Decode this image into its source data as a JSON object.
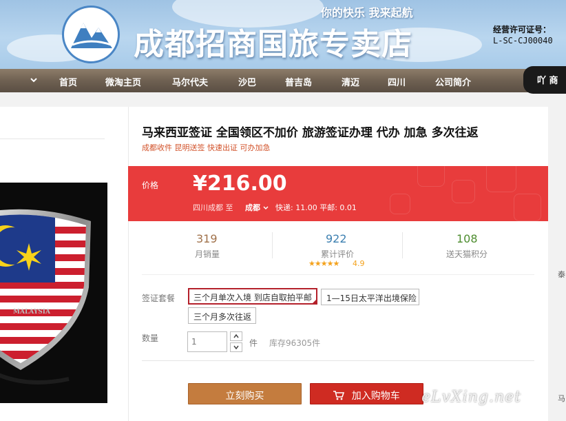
{
  "banner": {
    "store_name": "成都招商国旅专卖店",
    "slogan": "你的快乐  我来起航",
    "license_label": "经营许可证号：",
    "license_value": "L-SC-CJ00040"
  },
  "nav": {
    "items": [
      "首页",
      "微淘主页",
      "马尔代夫",
      "沙巴",
      "普吉岛",
      "清迈",
      "四川",
      "公司简介"
    ],
    "extra": "吖 商"
  },
  "product": {
    "title": "马来西亚签证 全国领区不加价 旅游签证办理 代办 加急 多次往返",
    "subtitle": "成都收件 昆明送签 快速出证 可办加急",
    "price_label": "价格",
    "price": "¥216.00",
    "ship_from": "四川成都  至",
    "ship_to": "成都",
    "ship_fees": "快递: 11.00  平邮: 0.01"
  },
  "stats": [
    {
      "value": "319",
      "label": "月销量",
      "color": "#a0714a"
    },
    {
      "value": "922",
      "label": "累计评价",
      "color": "#3c7fb0"
    },
    {
      "value": "108",
      "label": "送天猫积分",
      "color": "#4c8c2e"
    }
  ],
  "rating": {
    "stars": "★★★★★",
    "score": "4.9"
  },
  "package": {
    "label": "签证套餐",
    "options": [
      "三个月单次入境 到店自取拍平邮",
      "1—15日太平洋出境保险",
      "三个月多次往返"
    ],
    "selected_index": 0
  },
  "quantity": {
    "label": "数量",
    "value": "1",
    "unit": "件",
    "stock": "库存96305件"
  },
  "actions": {
    "buy_now": "立刻购买",
    "add_to_cart": "加入购物车"
  },
  "side": {
    "text_1": "泰",
    "text_2": "马"
  },
  "watermark": "eLvXing.net",
  "image_caption": "MALAYSIA",
  "colors": {
    "price_red": "#e83c3c",
    "buy_brown": "#c47c3e",
    "cart_red": "#cf2b22",
    "selected_border": "#b4202a"
  },
  "icons": [
    "nav-chevron-icon",
    "cart-icon",
    "stepper-up-icon",
    "stepper-down-icon",
    "select-chevron-icon"
  ]
}
